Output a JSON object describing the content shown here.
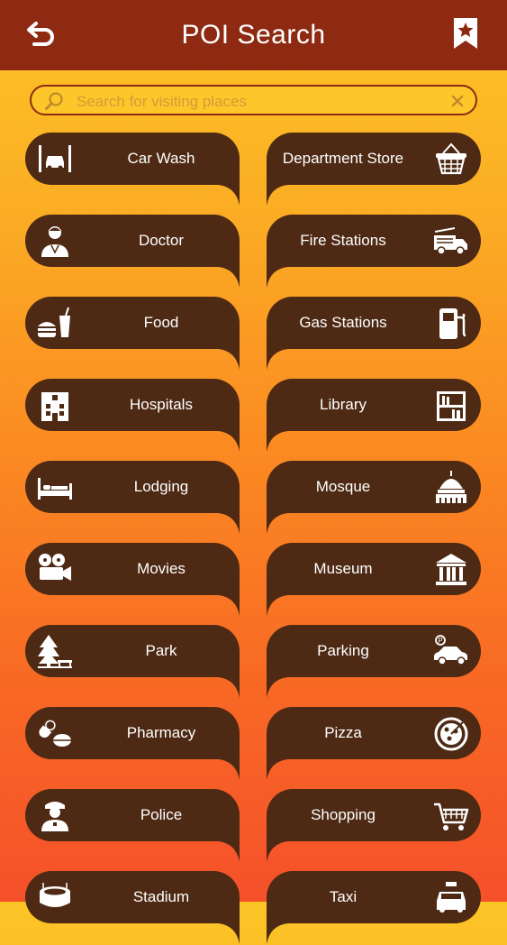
{
  "header": {
    "title": "POI Search",
    "back_icon": "back-arrow-icon",
    "bookmark_icon": "bookmark-star-icon"
  },
  "search": {
    "placeholder": "Search for visiting places",
    "value": "",
    "search_icon": "magnifier-icon",
    "clear_icon": "clear-x-icon"
  },
  "colors": {
    "header_bg": "#8e2a12",
    "tile_bg": "#4e2a14",
    "gradient_top": "#fcc526",
    "gradient_bottom": "#f5502a"
  },
  "categories": [
    {
      "label": "Car Wash",
      "icon": "car-wash-icon"
    },
    {
      "label": "Department Store",
      "icon": "shopping-basket-icon"
    },
    {
      "label": "Doctor",
      "icon": "doctor-icon"
    },
    {
      "label": "Fire Stations",
      "icon": "fire-truck-icon"
    },
    {
      "label": "Food",
      "icon": "burger-drink-icon"
    },
    {
      "label": "Gas Stations",
      "icon": "gas-pump-icon"
    },
    {
      "label": "Hospitals",
      "icon": "hospital-building-icon"
    },
    {
      "label": "Library",
      "icon": "bookshelf-icon"
    },
    {
      "label": "Lodging",
      "icon": "bed-icon"
    },
    {
      "label": "Mosque",
      "icon": "mosque-dome-icon"
    },
    {
      "label": "Movies",
      "icon": "film-camera-icon"
    },
    {
      "label": "Museum",
      "icon": "museum-columns-icon"
    },
    {
      "label": "Park",
      "icon": "tree-bench-icon"
    },
    {
      "label": "Parking",
      "icon": "parking-car-icon"
    },
    {
      "label": "Pharmacy",
      "icon": "pills-icon"
    },
    {
      "label": "Pizza",
      "icon": "pizza-icon"
    },
    {
      "label": "Police",
      "icon": "police-officer-icon"
    },
    {
      "label": "Shopping",
      "icon": "shopping-cart-icon"
    },
    {
      "label": "Stadium",
      "icon": "stadium-icon"
    },
    {
      "label": "Taxi",
      "icon": "taxi-icon"
    }
  ]
}
